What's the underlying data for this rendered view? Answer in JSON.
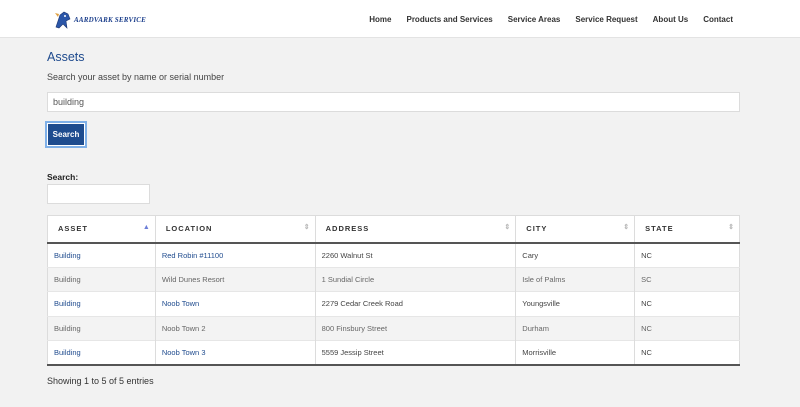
{
  "header": {
    "logo_text": "AARDVARK SERVICE",
    "nav": [
      "Home",
      "Products and Services",
      "Service Areas",
      "Service Request",
      "About Us",
      "Contact"
    ]
  },
  "page": {
    "title": "Assets",
    "subtitle": "Search your asset by name or serial number",
    "search_value": "building",
    "search_button": "Search",
    "filter_label": "Search:",
    "filter_value": ""
  },
  "table": {
    "columns": [
      "ASSET",
      "LOCATION",
      "ADDRESS",
      "CITY",
      "STATE"
    ],
    "sorted_column": "ASSET",
    "rows": [
      [
        "Building",
        "Red Robin #11100",
        "2260 Walnut St",
        "Cary",
        "NC"
      ],
      [
        "Building",
        "Wild Dunes Resort",
        "1 Sundial Circle",
        "Isle of Palms",
        "SC"
      ],
      [
        "Building",
        "Noob Town",
        "2279 Cedar Creek Road",
        "Youngsville",
        "NC"
      ],
      [
        "Building",
        "Noob Town 2",
        "800 Finsbury Street",
        "Durham",
        "NC"
      ],
      [
        "Building",
        "Noob Town 3",
        "5559 Jessip Street",
        "Morrisville",
        "NC"
      ]
    ]
  },
  "footer_info": "Showing 1 to 5 of 5 entries",
  "colors": {
    "accent": "#1e4c8f",
    "link": "#1f4b8e"
  }
}
